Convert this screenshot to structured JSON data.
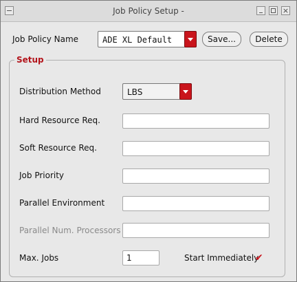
{
  "window": {
    "title": "Job Policy Setup -",
    "close_glyph": "×"
  },
  "job_policy": {
    "label": "Job Policy Name",
    "selected": "ADE XL Default",
    "save_label": "Save...",
    "delete_label": "Delete"
  },
  "setup": {
    "title": "Setup",
    "distribution_method": {
      "label": "Distribution Method",
      "selected": "LBS"
    },
    "hard_resource": {
      "label": "Hard Resource Req.",
      "value": ""
    },
    "soft_resource": {
      "label": "Soft Resource Req.",
      "value": ""
    },
    "job_priority": {
      "label": "Job Priority",
      "value": ""
    },
    "parallel_env": {
      "label": "Parallel Environment",
      "value": ""
    },
    "parallel_num_processors": {
      "label": "Parallel Num. Processors",
      "value": "",
      "disabled": true
    },
    "max_jobs": {
      "label": "Max. Jobs",
      "value": "1"
    },
    "start_immediately": {
      "label": "Start Immediately",
      "checked": true,
      "check_glyph": "✔"
    }
  },
  "colors": {
    "accent": "#c9141c",
    "group_title": "#b3141b",
    "background": "#e8e8e8"
  }
}
